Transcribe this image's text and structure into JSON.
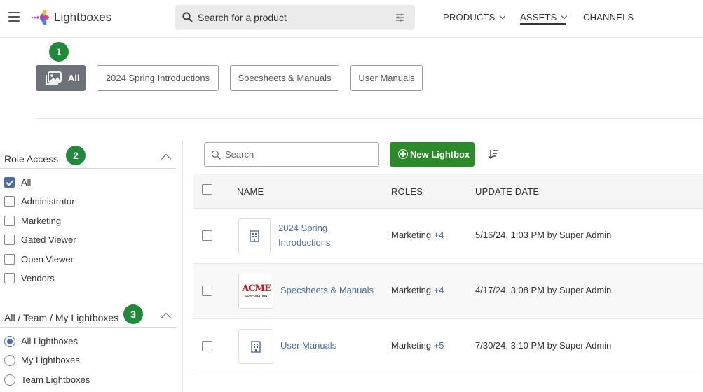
{
  "header": {
    "brand": "Lightboxes",
    "search_placeholder": "Search for a product",
    "nav": [
      {
        "label": "PRODUCTS",
        "dropdown": true
      },
      {
        "label": "ASSETS",
        "dropdown": true,
        "active": true
      },
      {
        "label": "CHANNELS",
        "dropdown": false
      }
    ]
  },
  "badges": [
    "1",
    "2",
    "3"
  ],
  "filters": [
    {
      "label": "All",
      "active": true
    },
    {
      "label": "2024 Spring Introductions"
    },
    {
      "label": "Specsheets & Manuals"
    },
    {
      "label": "User Manuals"
    }
  ],
  "sidebar": {
    "role_access": {
      "title": "Role Access",
      "options": [
        {
          "label": "All",
          "checked": true
        },
        {
          "label": "Administrator",
          "checked": false
        },
        {
          "label": "Marketing",
          "checked": false
        },
        {
          "label": "Gated Viewer",
          "checked": false
        },
        {
          "label": "Open Viewer",
          "checked": false
        },
        {
          "label": "Vendors",
          "checked": false
        }
      ]
    },
    "scope": {
      "title": "All / Team / My Lightboxes",
      "options": [
        {
          "label": "All Lightboxes",
          "selected": true
        },
        {
          "label": "My Lightboxes",
          "selected": false
        },
        {
          "label": "Team Lightboxes",
          "selected": false
        }
      ]
    }
  },
  "toolbar": {
    "search_placeholder": "Search",
    "new_button": "New Lightbox"
  },
  "table": {
    "columns": [
      "NAME",
      "ROLES",
      "UPDATE DATE"
    ],
    "rows": [
      {
        "name_line1": "2024 Spring",
        "name_line2": "Introductions",
        "thumbnail": "building-icon",
        "role": "Marketing",
        "role_more": "+4",
        "updated": "5/16/24, 1:03 PM by Super Admin"
      },
      {
        "name": "Specsheets & Manuals",
        "thumbnail": "acme-logo",
        "logo_text": "ACME",
        "logo_sub": "CORPORATION",
        "role": "Marketing",
        "role_more": "+4",
        "updated": "4/17/24, 3:08 PM by Super Admin"
      },
      {
        "name": "User Manuals",
        "thumbnail": "building-icon",
        "role": "Marketing",
        "role_more": "+5",
        "updated": "7/30/24, 3:10 PM by Super Admin"
      }
    ]
  },
  "colors": {
    "accent_green": "#2d8a2a",
    "badge_green": "#1e8a3a",
    "link_blue": "#4a6da7",
    "chip_active": "#6d7278"
  }
}
